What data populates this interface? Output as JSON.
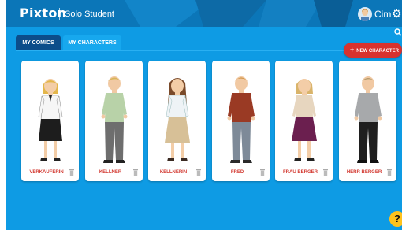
{
  "header": {
    "logo": "Pixton",
    "subtitle": "Solo Student",
    "username": "Cim",
    "icons": {
      "avatar": "user-avatar",
      "settings": "gear-icon",
      "search": "search-icon"
    }
  },
  "tabs": [
    {
      "label": "MY COMICS",
      "active": false
    },
    {
      "label": "MY CHARACTERS",
      "active": true
    }
  ],
  "new_character": {
    "label": "NEW CHARACTER",
    "icon": "plus-icon"
  },
  "characters": [
    {
      "name": "VERKÄUFERIN"
    },
    {
      "name": "KELLNER"
    },
    {
      "name": "KELLNERIN"
    },
    {
      "name": "FRED"
    },
    {
      "name": "FRAU BERGER"
    },
    {
      "name": "HERR BERGER"
    }
  ],
  "help": {
    "label": "?"
  },
  "colors": {
    "accent": "#d8322e",
    "background": "#0e9be4",
    "header": "#0b76b8",
    "tab_active": "#17a8ee",
    "tab_inactive": "#0c4d8a"
  }
}
